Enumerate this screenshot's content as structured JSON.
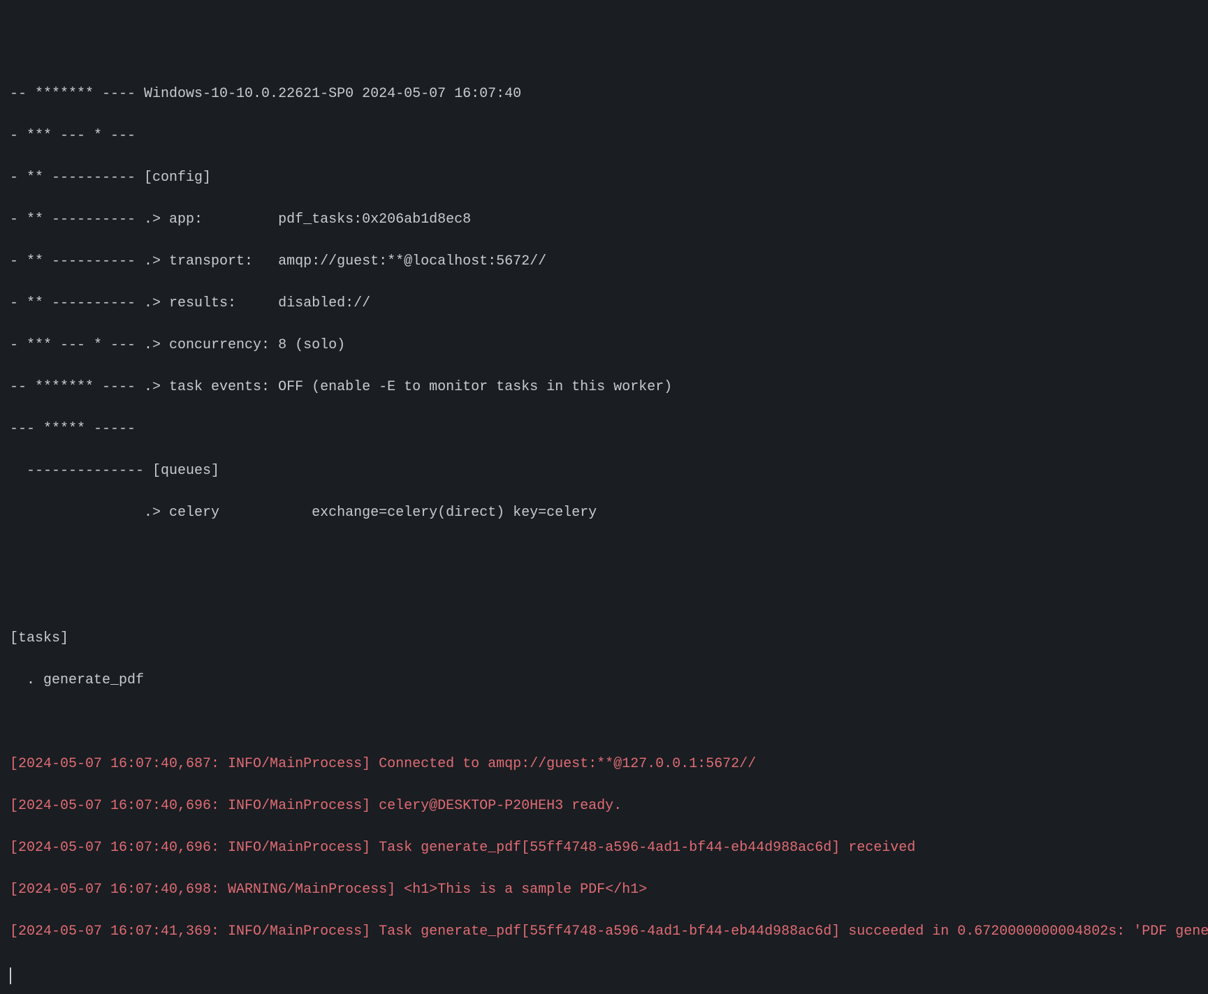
{
  "banner": {
    "line1": "-- ******* ---- Windows-10-10.0.22621-SP0 2024-05-07 16:07:40",
    "line2": "- *** --- * ---",
    "line3": "- ** ---------- [config]",
    "line4": "- ** ---------- .> app:         pdf_tasks:0x206ab1d8ec8",
    "line5": "- ** ---------- .> transport:   amqp://guest:**@localhost:5672//",
    "line6": "- ** ---------- .> results:     disabled://",
    "line7": "- *** --- * --- .> concurrency: 8 (solo)",
    "line8": "-- ******* ---- .> task events: OFF (enable -E to monitor tasks in this worker)",
    "line9": "--- ***** -----",
    "line10": "  -------------- [queues]",
    "line11": "                .> celery           exchange=celery(direct) key=celery"
  },
  "tasks": {
    "header": "[tasks]",
    "item1": "  . generate_pdf"
  },
  "logs": {
    "line1": "[2024-05-07 16:07:40,687: INFO/MainProcess] Connected to amqp://guest:**@127.0.0.1:5672//",
    "line2": "[2024-05-07 16:07:40,696: INFO/MainProcess] celery@DESKTOP-P20HEH3 ready.",
    "line3": "[2024-05-07 16:07:40,696: INFO/MainProcess] Task generate_pdf[55ff4748-a596-4ad1-bf44-eb44d988ac6d] received",
    "line4": "[2024-05-07 16:07:40,698: WARNING/MainProcess] <h1>This is a sample PDF</h1>",
    "line5": "[2024-05-07 16:07:41,369: INFO/MainProcess] Task generate_pdf[55ff4748-a596-4ad1-bf44-eb44d988ac6d] succeeded in 0.6720000000004802s: 'PDF gene"
  }
}
